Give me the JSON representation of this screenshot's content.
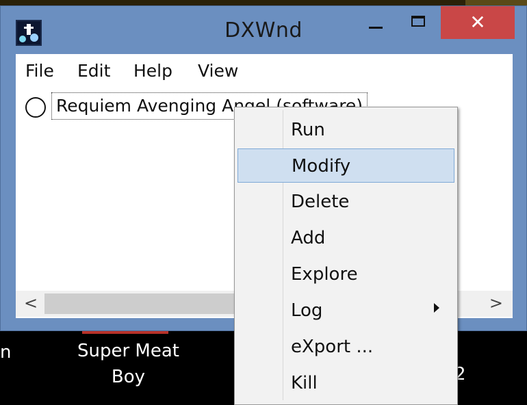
{
  "window": {
    "title": "DXWnd",
    "close_glyph": "✕",
    "icons": {
      "app": "dxwnd-app-icon",
      "minimize": "minimize-icon",
      "maximize": "maximize-icon",
      "close": "close-icon"
    }
  },
  "menubar": {
    "items": [
      "File",
      "Edit",
      "Help",
      "View"
    ]
  },
  "list": {
    "rows": [
      {
        "label": "Requiem Avenging Angel (software)",
        "icon": "radio-icon"
      }
    ]
  },
  "scrollbar": {
    "left": "<",
    "right": ">"
  },
  "context_menu": {
    "items": [
      {
        "label": "Run"
      },
      {
        "label": "Modify"
      },
      {
        "label": "Delete"
      },
      {
        "label": "Add"
      },
      {
        "label": "Explore"
      },
      {
        "label": "Log",
        "submenu": true
      },
      {
        "label": "eXport ..."
      },
      {
        "label": "Kill"
      }
    ],
    "highlighted": "Modify"
  },
  "desktop": {
    "labels": [
      "Super Meat Boy",
      "n",
      "2"
    ]
  },
  "colors": {
    "titlebar": "#6b8fc0",
    "close_button": "#c94747",
    "menu_highlight": "#cfdff0"
  }
}
